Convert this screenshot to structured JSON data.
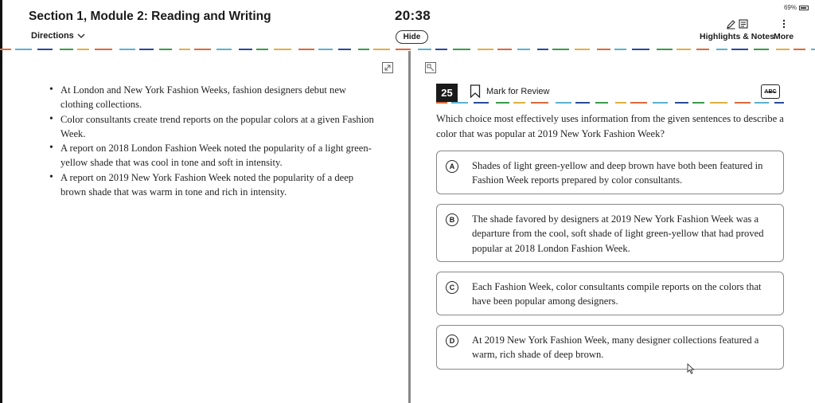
{
  "header": {
    "section_title": "Section 1, Module 2: Reading and Writing",
    "directions_label": "Directions",
    "timer": "20:38",
    "hide_label": "Hide",
    "battery": "69%",
    "highlights_label": "Highlights & Notes",
    "more_label": "More"
  },
  "passage": {
    "bullets": [
      "At London and New York Fashion Weeks, fashion designers debut new clothing collections.",
      "Color consultants create trend reports on the popular colors at a given Fashion Week.",
      "A report on 2018 London Fashion Week noted the popularity of a light green-yellow shade that was cool in tone and soft in intensity.",
      "A report on 2019 New York Fashion Week noted the popularity of a deep brown shade that was warm in tone and rich in intensity."
    ]
  },
  "question": {
    "number": "25",
    "mark_for_review": "Mark for Review",
    "abc_label": "ABC",
    "prompt": "Which choice most effectively uses information from the given sentences to describe a color that was popular at 2019 New York Fashion Week?",
    "choices": [
      {
        "letter": "A",
        "text": "Shades of light green-yellow and deep brown have both been featured in Fashion Week reports prepared by color consultants."
      },
      {
        "letter": "B",
        "text": "The shade favored by designers at 2019 New York Fashion Week was a departure from the cool, soft shade of light green-yellow that had proved popular at 2018 London Fashion Week."
      },
      {
        "letter": "C",
        "text": "Each Fashion Week, color consultants compile reports on the colors that have been popular among designers."
      },
      {
        "letter": "D",
        "text": "At 2019 New York Fashion Week, many designer collections featured a warm, rich shade of deep brown."
      }
    ]
  },
  "colors": {
    "dash_palette": [
      "#3a9a4a",
      "#d86a3a",
      "#2a4a9a",
      "#e0b040",
      "#5ab0d0"
    ]
  }
}
